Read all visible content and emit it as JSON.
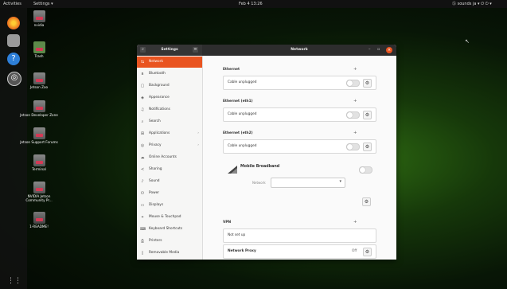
{
  "topbar": {
    "activities": "Activities",
    "app_menu": "Settings ▾",
    "clock": "Feb 4  13:26",
    "tray": "Ⓢ sounds   ja ▾   ⏻  ⏻ ▾"
  },
  "desktop": {
    "icons": [
      {
        "label": "nvidia"
      },
      {
        "label": "Trash"
      },
      {
        "label": "Jetson Zoo"
      },
      {
        "label": "Jetson Developer Zone"
      },
      {
        "label": "Jetson Support Forums"
      },
      {
        "label": "Terminal"
      },
      {
        "label": "NVIDIA Jetson Community Pr..."
      },
      {
        "label": "1-README!"
      }
    ]
  },
  "window": {
    "sidebar_title": "Settings",
    "title": "Network",
    "sidebar": [
      {
        "icon": "⇆",
        "label": "Network",
        "active": true
      },
      {
        "icon": "ʙ",
        "label": "Bluetooth"
      },
      {
        "icon": "▢",
        "label": "Background"
      },
      {
        "icon": "◈",
        "label": "Appearance"
      },
      {
        "icon": "♫",
        "label": "Notifications"
      },
      {
        "icon": "⌕",
        "label": "Search"
      },
      {
        "icon": "⊞",
        "label": "Applications",
        "chevron": "›"
      },
      {
        "icon": "◎",
        "label": "Privacy",
        "chevron": "›"
      },
      {
        "icon": "☁",
        "label": "Online Accounts"
      },
      {
        "icon": "≺",
        "label": "Sharing"
      },
      {
        "icon": "♪",
        "label": "Sound"
      },
      {
        "icon": "⏻",
        "label": "Power"
      },
      {
        "icon": "▭",
        "label": "Displays"
      },
      {
        "icon": "⌖",
        "label": "Mouse & Touchpad"
      },
      {
        "icon": "⌨",
        "label": "Keyboard Shortcuts"
      },
      {
        "icon": "⎙",
        "label": "Printers"
      },
      {
        "icon": "▯",
        "label": "Removable Media"
      }
    ],
    "ethernet": [
      {
        "title": "Ethernet",
        "status": "Cable unplugged"
      },
      {
        "title": "Ethernet (eth1)",
        "status": "Cable unplugged"
      },
      {
        "title": "Ethernet (eth2)",
        "status": "Cable unplugged"
      }
    ],
    "mobile": {
      "title": "Mobile Broadband",
      "network_label": "Network"
    },
    "vpn": {
      "title": "VPN",
      "status": "Not set up"
    },
    "proxy": {
      "title": "Network Proxy",
      "status": "Off"
    }
  },
  "colors": {
    "accent": "#e95420"
  }
}
